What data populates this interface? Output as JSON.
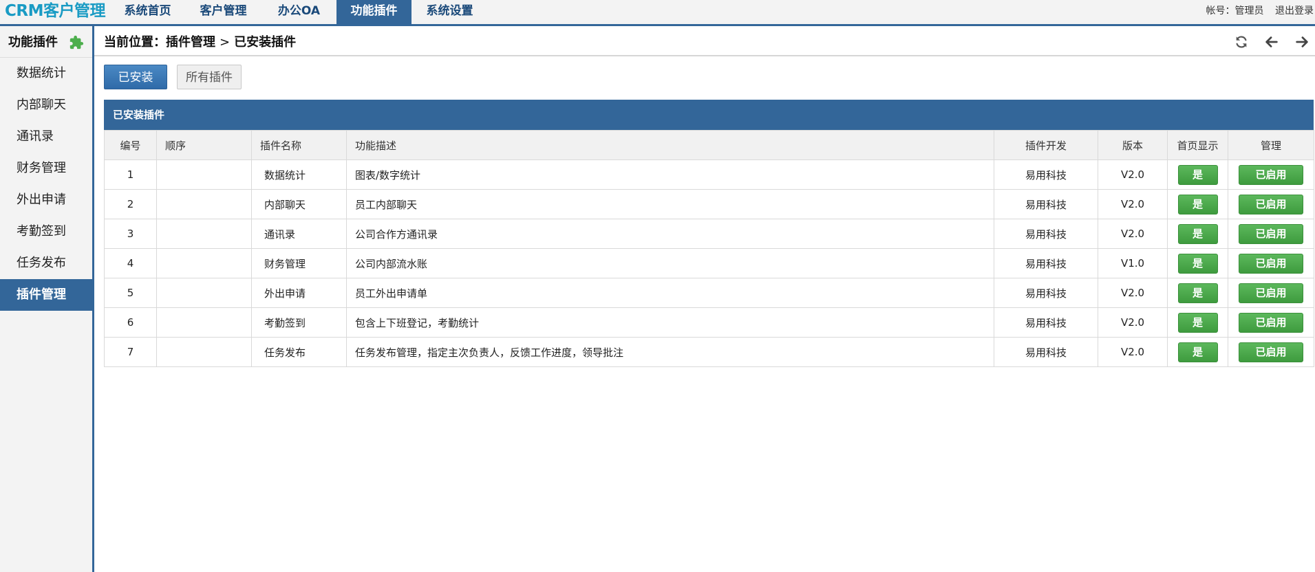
{
  "app": {
    "logo": "CRM客户管理"
  },
  "nav": [
    {
      "label": "系统首页",
      "active": false
    },
    {
      "label": "客户管理",
      "active": false
    },
    {
      "label": "办公OA",
      "active": false
    },
    {
      "label": "功能插件",
      "active": true
    },
    {
      "label": "系统设置",
      "active": false
    }
  ],
  "user": {
    "account": "帐号：管理员",
    "logout": "退出登录"
  },
  "sidebar": {
    "title": "功能插件",
    "title_icon": "puzzle-icon",
    "items": [
      {
        "label": "数据统计",
        "active": false
      },
      {
        "label": "内部聊天",
        "active": false
      },
      {
        "label": "通讯录",
        "active": false
      },
      {
        "label": "财务管理",
        "active": false
      },
      {
        "label": "外出申请",
        "active": false
      },
      {
        "label": "考勤签到",
        "active": false
      },
      {
        "label": "任务发布",
        "active": false
      },
      {
        "label": "插件管理",
        "active": true
      }
    ]
  },
  "breadcrumb": {
    "prefix": "当前位置：插件管理",
    "separator": ">",
    "current": "已安装插件",
    "tools": [
      "refresh-icon",
      "arrow-left-icon",
      "arrow-right-icon"
    ]
  },
  "tabs": {
    "installed": "已安装",
    "all": "所有插件"
  },
  "panel": {
    "title": "已安装插件",
    "columns": [
      "编号",
      "顺序",
      "插件名称",
      "功能描述",
      "插件开发",
      "版本",
      "首页显示",
      "管理"
    ],
    "rows": [
      {
        "id": "1",
        "order": "",
        "name": "数据统计",
        "desc": "图表/数字统计",
        "dev": "易用科技",
        "version": "V2.0",
        "home": "是",
        "manage": "已启用"
      },
      {
        "id": "2",
        "order": "",
        "name": "内部聊天",
        "desc": "员工内部聊天",
        "dev": "易用科技",
        "version": "V2.0",
        "home": "是",
        "manage": "已启用"
      },
      {
        "id": "3",
        "order": "",
        "name": "通讯录",
        "desc": "公司合作方通讯录",
        "dev": "易用科技",
        "version": "V2.0",
        "home": "是",
        "manage": "已启用"
      },
      {
        "id": "4",
        "order": "",
        "name": "财务管理",
        "desc": "公司内部流水账",
        "dev": "易用科技",
        "version": "V1.0",
        "home": "是",
        "manage": "已启用"
      },
      {
        "id": "5",
        "order": "",
        "name": "外出申请",
        "desc": "员工外出申请单",
        "dev": "易用科技",
        "version": "V2.0",
        "home": "是",
        "manage": "已启用"
      },
      {
        "id": "6",
        "order": "",
        "name": "考勤签到",
        "desc": "包含上下班登记，考勤统计",
        "dev": "易用科技",
        "version": "V2.0",
        "home": "是",
        "manage": "已启用"
      },
      {
        "id": "7",
        "order": "",
        "name": "任务发布",
        "desc": "任务发布管理，指定主次负责人，反馈工作进度，领导批注",
        "dev": "易用科技",
        "version": "V2.0",
        "home": "是",
        "manage": "已启用"
      }
    ]
  },
  "colors": {
    "brand": "#336699",
    "logo": "#1a9bc4",
    "success": "#4cae4c"
  }
}
